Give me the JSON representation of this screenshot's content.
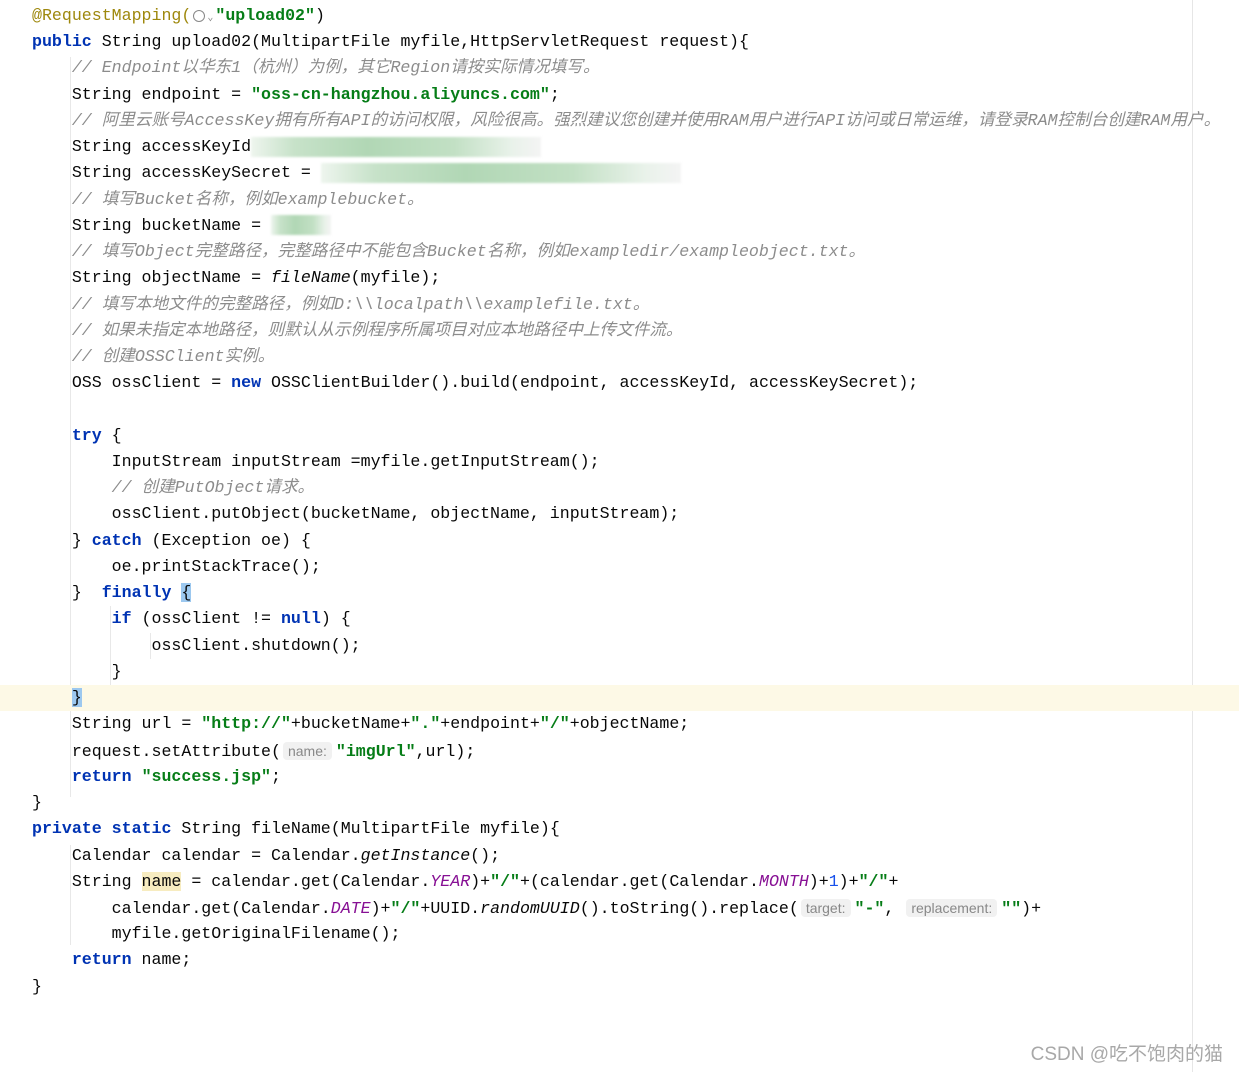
{
  "lines": [
    [
      [
        "ann",
        "@RequestMapping("
      ],
      [
        "globe",
        ""
      ],
      [
        "str",
        "\"upload02\""
      ],
      [
        "",
        ")"
      ]
    ],
    [
      [
        "kw",
        "public"
      ],
      [
        "",
        " String upload02(MultipartFile myfile,HttpServletRequest request){"
      ]
    ],
    [
      [
        "cmt",
        "    // Endpoint以华东1（杭州）为例，其它Region请按实际情况填写。"
      ]
    ],
    [
      [
        "",
        "    String endpoint = "
      ],
      [
        "str",
        "\"oss-cn-hangzhou.aliyuncs.com\""
      ],
      [
        "",
        ";"
      ]
    ],
    [
      [
        "cmt",
        "    // 阿里云账号AccessKey拥有所有API的访问权限，风险很高。强烈建议您创建并使用RAM用户进行API访问或日常运维，请登录RAM控制台创建RAM用户。"
      ]
    ],
    [
      [
        "",
        "    String accessKeyId"
      ],
      [
        "blur-id",
        ""
      ]
    ],
    [
      [
        "",
        "    String accessKeySecret = "
      ],
      [
        "blur-secret",
        ""
      ]
    ],
    [
      [
        "cmt",
        "    // 填写Bucket名称，例如examplebucket。"
      ]
    ],
    [
      [
        "",
        "    String bucketName = "
      ],
      [
        "blur-bucket",
        ""
      ]
    ],
    [
      [
        "cmt",
        "    // 填写Object完整路径，完整路径中不能包含Bucket名称，例如exampledir/exampleobject.txt。"
      ]
    ],
    [
      [
        "",
        "    String objectName = "
      ],
      [
        "ital",
        "fileName"
      ],
      [
        "",
        "(myfile);"
      ]
    ],
    [
      [
        "cmt",
        "    // 填写本地文件的完整路径，例如D:\\\\localpath\\\\examplefile.txt。"
      ]
    ],
    [
      [
        "cmt",
        "    // 如果未指定本地路径，则默认从示例程序所属项目对应本地路径中上传文件流。"
      ]
    ],
    [
      [
        "cmt",
        "    // 创建OSSClient实例。"
      ]
    ],
    [
      [
        "",
        "    OSS ossClient = "
      ],
      [
        "kw",
        "new"
      ],
      [
        "",
        " OSSClientBuilder().build(endpoint, accessKeyId, accessKeySecret);"
      ]
    ],
    [],
    [
      [
        "",
        "    "
      ],
      [
        "kw",
        "try"
      ],
      [
        "",
        " {"
      ]
    ],
    [
      [
        "",
        "        InputStream inputStream =myfile.getInputStream();"
      ]
    ],
    [
      [
        "cmt",
        "        // 创建PutObject请求。"
      ]
    ],
    [
      [
        "",
        "        ossClient.putObject(bucketName, objectName, inputStream);"
      ]
    ],
    [
      [
        "",
        "    } "
      ],
      [
        "kw",
        "catch"
      ],
      [
        "",
        " (Exception oe) {"
      ]
    ],
    [
      [
        "",
        "        oe.printStackTrace();"
      ]
    ],
    [
      [
        "",
        "    }  "
      ],
      [
        "kw",
        "finally"
      ],
      [
        "",
        " "
      ],
      [
        "bracehl",
        "{"
      ]
    ],
    [
      [
        "",
        "        "
      ],
      [
        "kw",
        "if"
      ],
      [
        "",
        " (ossClient != "
      ],
      [
        "kw",
        "null"
      ],
      [
        "",
        ") {"
      ]
    ],
    [
      [
        "",
        "            ossClient.shutdown();"
      ]
    ],
    [
      [
        "",
        "        }"
      ]
    ],
    [
      [
        "",
        "    "
      ],
      [
        "bracehl",
        "}"
      ]
    ],
    [
      [
        "",
        "    String url = "
      ],
      [
        "str",
        "\"http://\""
      ],
      [
        "",
        "+bucketName+"
      ],
      [
        "str",
        "\".\""
      ],
      [
        "",
        "+endpoint+"
      ],
      [
        "str",
        "\"/\""
      ],
      [
        "",
        "+objectName;"
      ]
    ],
    [
      [
        "",
        "    request.setAttribute("
      ],
      [
        "hint",
        "name:"
      ],
      [
        "str",
        "\"imgUrl\""
      ],
      [
        "",
        ",url);"
      ]
    ],
    [
      [
        "",
        "    "
      ],
      [
        "kw",
        "return"
      ],
      [
        "",
        " "
      ],
      [
        "str",
        "\"success.jsp\""
      ],
      [
        "",
        ";"
      ]
    ],
    [
      [
        "",
        "}"
      ]
    ],
    [
      [
        "kw",
        "private static"
      ],
      [
        "",
        " String fileName(MultipartFile myfile){"
      ]
    ],
    [
      [
        "",
        "    Calendar calendar = Calendar."
      ],
      [
        "ital",
        "getInstance"
      ],
      [
        "",
        "();"
      ]
    ],
    [
      [
        "",
        "    String "
      ],
      [
        "namehl",
        "name"
      ],
      [
        "",
        " = calendar.get(Calendar."
      ],
      [
        "static",
        "YEAR"
      ],
      [
        "",
        ")+"
      ],
      [
        "str",
        "\"/\""
      ],
      [
        "",
        "+(calendar.get(Calendar."
      ],
      [
        "static",
        "MONTH"
      ],
      [
        "",
        ")+"
      ],
      [
        "num",
        "1"
      ],
      [
        "",
        ")+"
      ],
      [
        "str",
        "\"/\""
      ],
      [
        "",
        "+"
      ]
    ],
    [
      [
        "",
        "        calendar.get(Calendar."
      ],
      [
        "static",
        "DATE"
      ],
      [
        "",
        ")+"
      ],
      [
        "str",
        "\"/\""
      ],
      [
        "",
        "+UUID."
      ],
      [
        "ital",
        "randomUUID"
      ],
      [
        "",
        "().toString().replace("
      ],
      [
        "hint",
        "target:"
      ],
      [
        "str",
        "\"-\""
      ],
      [
        "",
        ", "
      ],
      [
        "hint",
        "replacement:"
      ],
      [
        "str",
        "\"\""
      ],
      [
        "",
        ")+"
      ]
    ],
    [
      [
        "",
        "        myfile.getOriginalFilename();"
      ]
    ],
    [
      [
        "",
        "    "
      ],
      [
        "kw",
        "return"
      ],
      [
        "",
        " name;"
      ]
    ],
    [
      [
        "",
        "}"
      ]
    ]
  ],
  "current_line": 26,
  "watermark": "CSDN @吃不饱肉的猫"
}
